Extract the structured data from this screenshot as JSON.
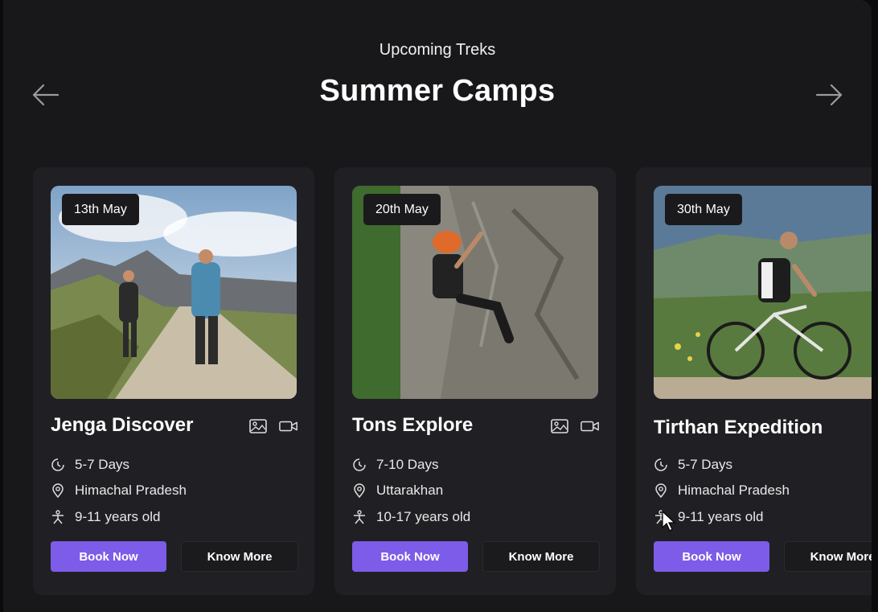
{
  "header": {
    "subtitle": "Upcoming Treks",
    "title": "Summer Camps"
  },
  "colors": {
    "accent": "#7c5ce8",
    "background": "#18181b",
    "card": "#202024"
  },
  "icons": {
    "prev": "arrow-left-icon",
    "next": "arrow-right-icon",
    "duration": "clock-icon",
    "location": "map-pin-icon",
    "age": "person-icon",
    "gallery": "image-icon",
    "video": "video-camera-icon"
  },
  "cards": [
    {
      "date": "13th May",
      "name": "Jenga Discover",
      "duration": "5-7 Days",
      "location": "Himachal Pradesh",
      "age": "9-11 years old",
      "book_label": "Book Now",
      "more_label": "Know More",
      "photo": "hikers-on-mountain-trail"
    },
    {
      "date": "20th May",
      "name": "Tons Explore",
      "duration": "7-10 Days",
      "location": "Uttarakhan",
      "age": "10-17 years old",
      "book_label": "Book Now",
      "more_label": "Know More",
      "photo": "child-rock-climbing"
    },
    {
      "date": "30th May",
      "name": "Tirthan Expedition",
      "duration": "5-7 Days",
      "location": "Himachal Pradesh",
      "age": "9-11 years old",
      "book_label": "Book Now",
      "more_label": "Know More",
      "photo": "cyclist-on-road"
    }
  ]
}
